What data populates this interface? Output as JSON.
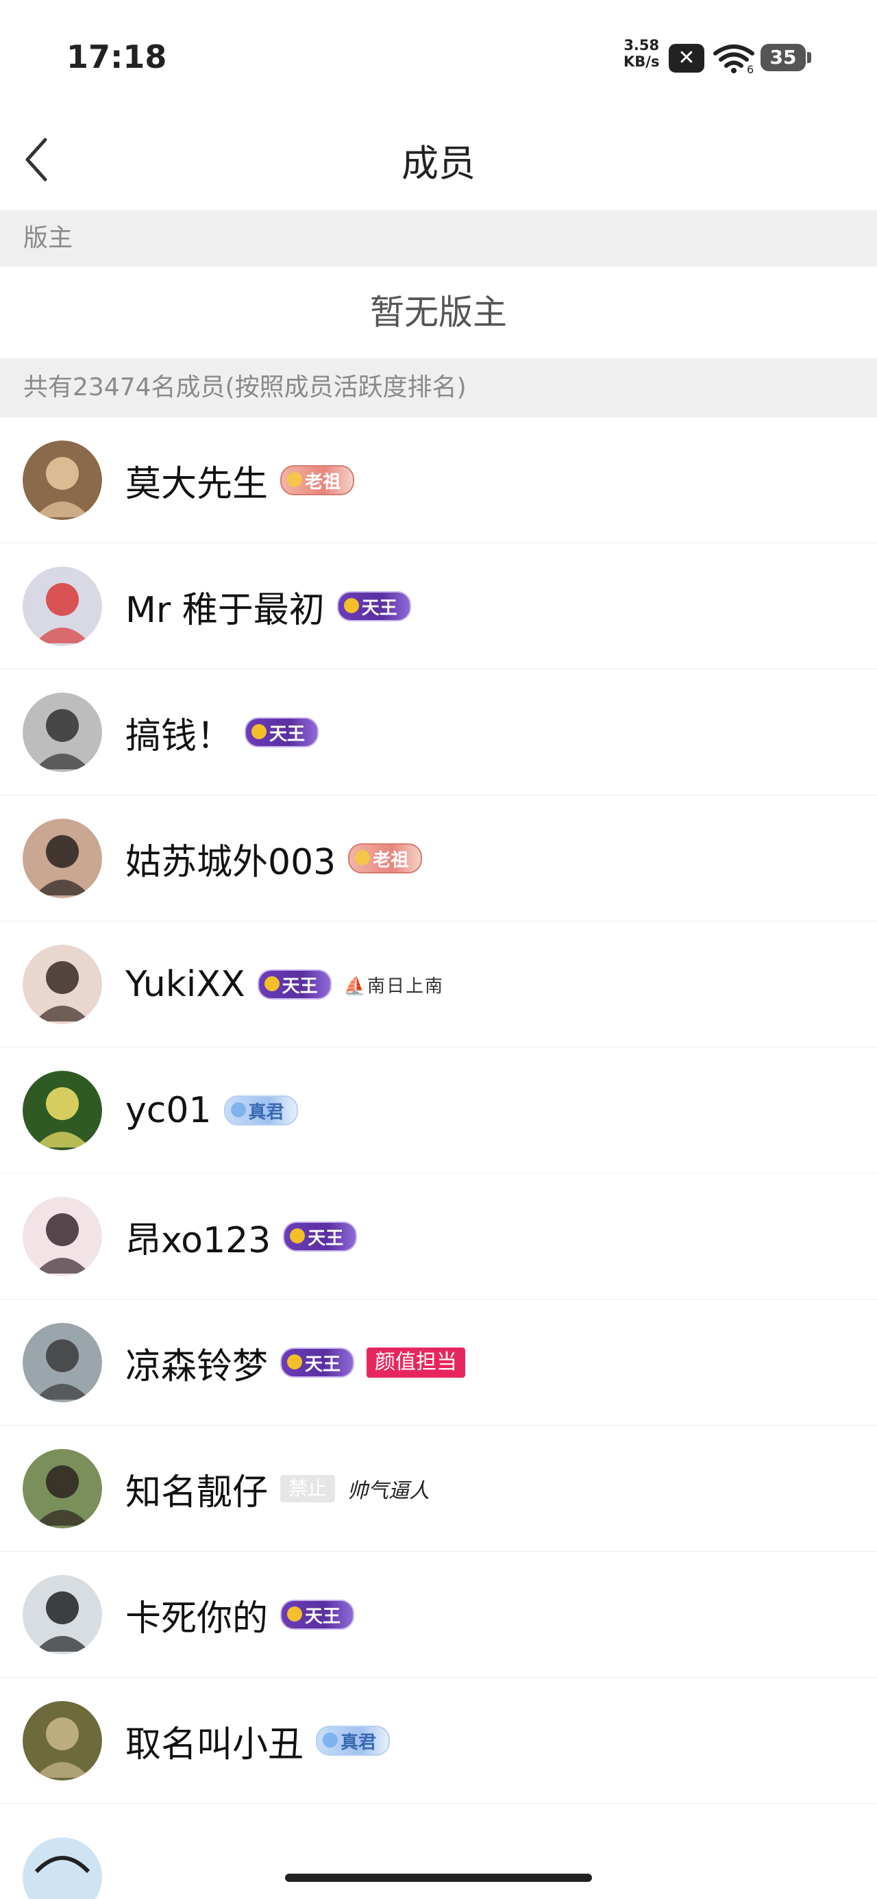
{
  "status_bar": {
    "time": "17:18",
    "net_speed_value": "3.58",
    "net_speed_unit": "KB/s",
    "x_badge": "✕",
    "wifi_label": "6",
    "battery": "35"
  },
  "header": {
    "title": "成员"
  },
  "moderator_section": {
    "label": "版主",
    "empty_text": "暂无版主"
  },
  "members_section": {
    "label": "共有23474名成员(按照成员活跃度排名)"
  },
  "members": [
    {
      "name": "莫大先生",
      "badge": "老祖",
      "badge_style": "laozu",
      "avatar_color": "#8a6a4a",
      "avatar_accent": "#e8c9a0"
    },
    {
      "name": "Mr 稚于最初",
      "badge": "天王",
      "badge_style": "tianwang",
      "avatar_color": "#d9d9e6",
      "avatar_accent": "#d83a3a"
    },
    {
      "name": "搞钱！",
      "badge": "天王",
      "badge_style": "tianwang",
      "avatar_color": "#bdbdbd",
      "avatar_accent": "#333333"
    },
    {
      "name": "姑苏城外003",
      "badge": "老祖",
      "badge_style": "laozu",
      "avatar_color": "#caa792",
      "avatar_accent": "#2a2220"
    },
    {
      "name": "YukiXX",
      "badge": "天王",
      "badge_style": "tianwang",
      "extra_tag": "⛵南日上南",
      "extra_style": "box",
      "avatar_color": "#e9d6cf",
      "avatar_accent": "#3a2a24"
    },
    {
      "name": "yc01",
      "badge": "真君",
      "badge_style": "zhenren",
      "avatar_color": "#2f5a23",
      "avatar_accent": "#f2e36a"
    },
    {
      "name": "昂xo123",
      "badge": "天王",
      "badge_style": "tianwang",
      "avatar_color": "#f1e3e6",
      "avatar_accent": "#3a2a30"
    },
    {
      "name": "凉森铃梦",
      "badge": "天王",
      "badge_style": "tianwang",
      "extra_tag": "颜值担当",
      "extra_style": "pink",
      "avatar_color": "#9aa6ac",
      "avatar_accent": "#3b3b3b"
    },
    {
      "name": "知名靓仔",
      "badge": "禁止",
      "badge_style": "ban",
      "extra_tag": "帅气逼人",
      "extra_style": "cursive",
      "avatar_color": "#7a8f5a",
      "avatar_accent": "#2d2420"
    },
    {
      "name": "卡死你的",
      "badge": "天王",
      "badge_style": "tianwang",
      "avatar_color": "#d8dde2",
      "avatar_accent": "#222222"
    },
    {
      "name": "取名叫小丑",
      "badge": "真君",
      "badge_style": "zhenren",
      "avatar_color": "#6d6a3c",
      "avatar_accent": "#c9b88a"
    }
  ]
}
